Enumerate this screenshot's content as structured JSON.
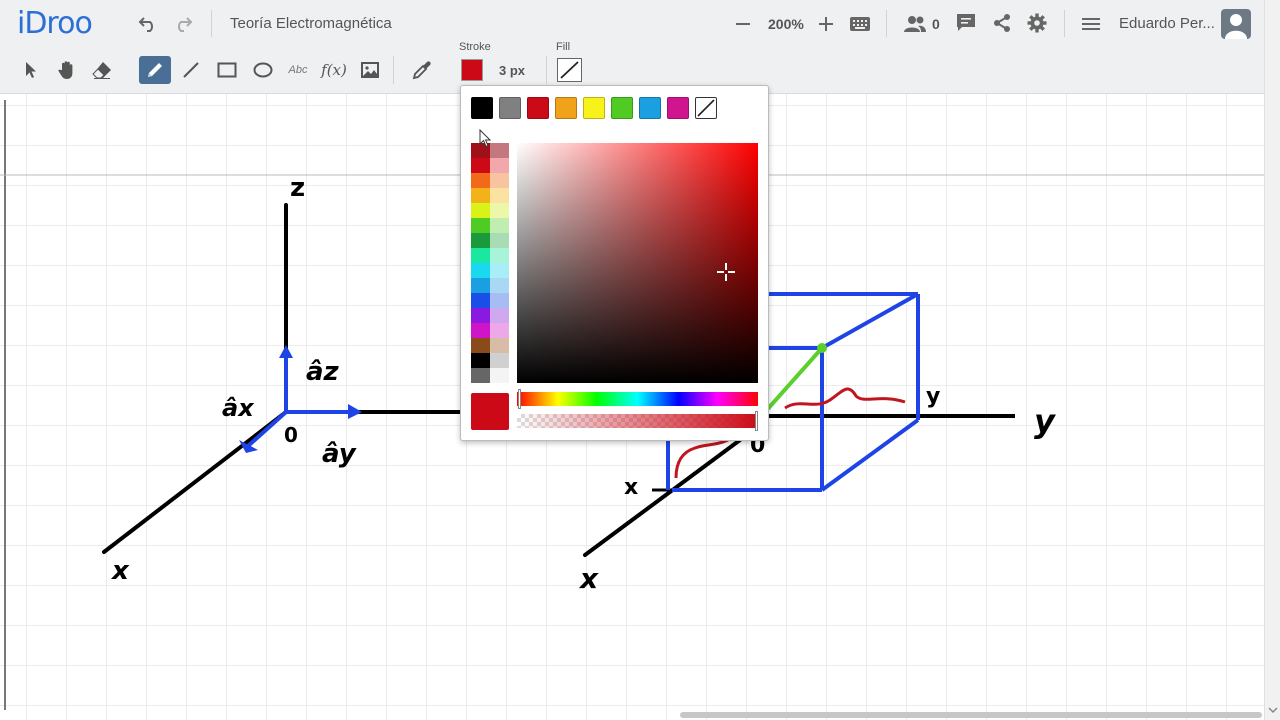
{
  "app": {
    "logo": "iDroo",
    "doc_title": "Teoría Electromagnética"
  },
  "header": {
    "zoom_out_icon": "minus-icon",
    "zoom_level": "200%",
    "zoom_in_icon": "plus-icon",
    "users_count": "0",
    "user_name": "Eduardo Per..."
  },
  "toolbar": {
    "stroke_label": "Stroke",
    "stroke_width": "3 px",
    "fill_label": "Fill",
    "text_tool_label": "Abc",
    "formula_tool_label": "f(x)"
  },
  "colors": {
    "accent": "#2c6fd6",
    "stroke": "#cc0a17",
    "active_tool": "#4a6f96"
  },
  "color_picker": {
    "presets": [
      "#000000",
      "#808080",
      "#cc0a17",
      "#f0a21a",
      "#f7f21a",
      "#4fcb24",
      "#1a9fe0",
      "#d0158f",
      "none"
    ],
    "current": "#cc0a17"
  },
  "drawing_labels": {
    "z_axis": "z",
    "x_axis_left": "x",
    "az": "âz",
    "ax": "âx",
    "ay": "ây",
    "origin_left": "0",
    "y_axis_right": "y",
    "y_label_right": "y",
    "x_label_right": "x",
    "x_axis_right": "x",
    "origin_right": "0"
  }
}
